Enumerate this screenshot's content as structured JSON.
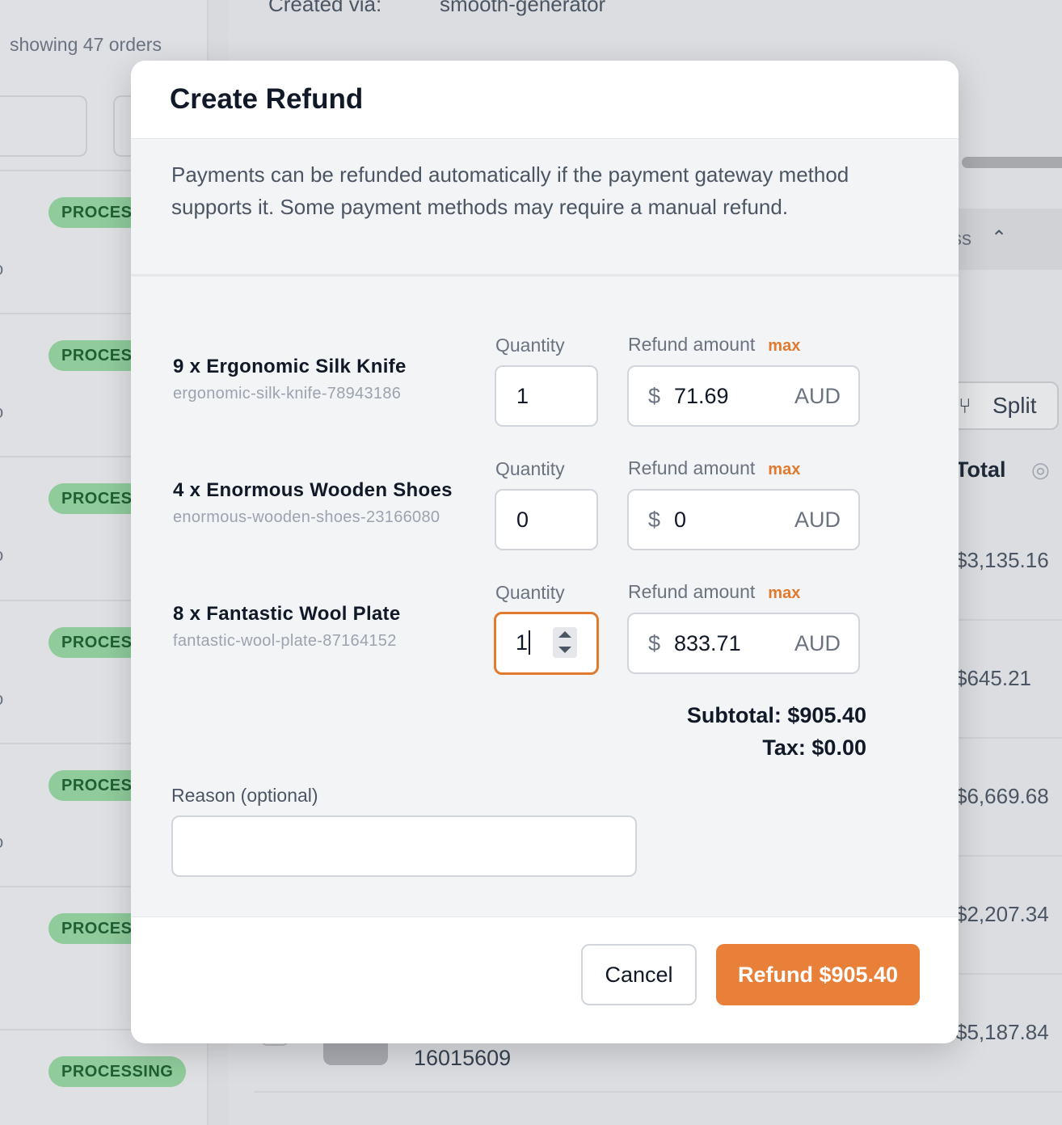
{
  "background": {
    "created_via_label": "Created via:",
    "created_via_value": "smooth-generator",
    "showing_text": "showing 47 orders",
    "status_badges": [
      "PROCESS",
      "PROCESS",
      "PROCESS",
      "PROCESS",
      "PROCESS",
      "PROCESS",
      "PROCESSING"
    ],
    "column_fragment": "ss",
    "split_label": "Split",
    "total_header": "Total",
    "amounts": [
      "$3,135.16",
      "$645.21",
      "$6,669.68",
      "$2,207.34",
      "$5,187.84"
    ],
    "order_number": "16015609"
  },
  "modal": {
    "title": "Create Refund",
    "description": "Payments can be refunded automatically if the payment gateway method supports it. Some payment methods may require a manual refund.",
    "quantity_label": "Quantity",
    "refund_amount_label": "Refund amount",
    "max_label": "max",
    "currency_symbol": "$",
    "currency_code": "AUD",
    "items": [
      {
        "name": "9 x Ergonomic Silk Knife",
        "sku": "ergonomic-silk-knife-78943186",
        "quantity": "1",
        "amount": "71.69"
      },
      {
        "name": "4 x Enormous Wooden Shoes",
        "sku": "enormous-wooden-shoes-23166080",
        "quantity": "0",
        "amount": "0"
      },
      {
        "name": "8 x Fantastic Wool Plate",
        "sku": "fantastic-wool-plate-87164152",
        "quantity": "1",
        "amount": "833.71"
      }
    ],
    "subtotal": "Subtotal: $905.40",
    "tax": "Tax: $0.00",
    "reason_label": "Reason (optional)",
    "reason_value": "",
    "cancel_label": "Cancel",
    "refund_button_label": "Refund $905.40"
  },
  "colors": {
    "accent": "#e8803a",
    "badge_bg": "#8fcb9b",
    "badge_text": "#1f5f33"
  }
}
